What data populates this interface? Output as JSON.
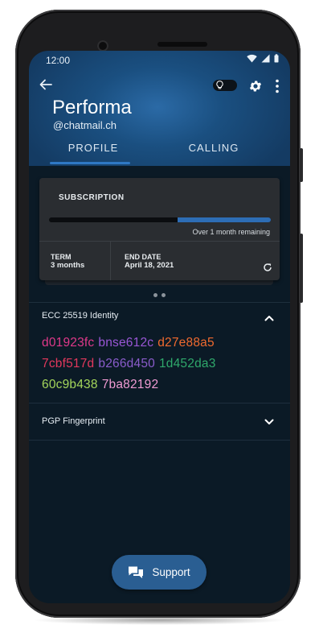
{
  "status_bar": {
    "time": "12:00"
  },
  "header": {
    "title": "Performa",
    "handle": "@chatmail.ch",
    "tabs": [
      {
        "label": "PROFILE",
        "active": true
      },
      {
        "label": "CALLING",
        "active": false
      }
    ],
    "icons": [
      "back-arrow-icon",
      "theme-toggle-icon",
      "gear-icon",
      "more-vert-icon"
    ]
  },
  "subscription": {
    "label": "SUBSCRIPTION",
    "progress_used_fraction": 0.58,
    "remaining_text": "Over 1 month remaining",
    "term_label": "TERM",
    "term_value": "3 months",
    "end_date_label": "END DATE",
    "end_date_value": "April 18, 2021"
  },
  "identity": {
    "title": "ECC 25519 Identity",
    "expanded": true,
    "fingerprint": [
      {
        "text": "d01923fc",
        "color": "#e0398a"
      },
      {
        "text": "bnse612c",
        "color": "#9a57d6"
      },
      {
        "text": "d27e88a5",
        "color": "#f06a2f"
      },
      {
        "text": "7cbf517d",
        "color": "#e2385c"
      },
      {
        "text": "b266d450",
        "color": "#8a5ccb"
      },
      {
        "text": "1d452da3",
        "color": "#2fa86b"
      },
      {
        "text": "60c9b438",
        "color": "#a4d65b"
      },
      {
        "text": "7ba82192",
        "color": "#f09bd3"
      }
    ]
  },
  "pgp": {
    "title": "PGP Fingerprint",
    "expanded": false
  },
  "support_button": {
    "label": "Support"
  },
  "colors": {
    "accent": "#2d6db5",
    "header": "#1a4f80",
    "background": "#0b1a26",
    "card": "#2a2d31"
  }
}
